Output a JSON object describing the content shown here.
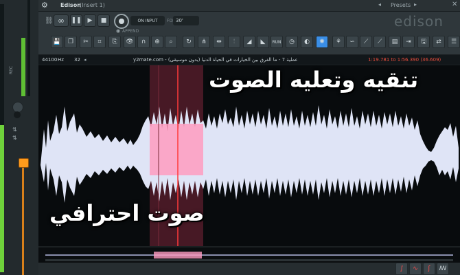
{
  "window": {
    "title": "Edison",
    "subtitle": "(Insert 1)",
    "presets_label": "Presets",
    "logo": "edison"
  },
  "left_strip": {
    "rec_label": "REC",
    "meter_color": "#6fd13b",
    "fader_color": "#ff9b1c"
  },
  "controls": {
    "loop_icon": "infinity-icon",
    "input_mode": "ON INPUT",
    "for_label": "FOR",
    "duration": "30'",
    "append_label": "APPEND"
  },
  "info": {
    "sample_rate": "44100",
    "sample_unit": "Hz",
    "bits": "32",
    "filename": "y2mate.com - عملية 7 - ما الفرق بين الخيارات في الحياة الدنيا (بدون موسيقى)",
    "selection": "1:19.781 to 1:56.390 (36.609)"
  },
  "overlay_text": {
    "top": "تنقيه وتعليه الصوت",
    "bottom": "صوت احترافي"
  },
  "colors": {
    "waveform": "#dfe4f6",
    "selection": "#ff9cc0",
    "selection_region": "#5c1f2e",
    "playhead": "#ff3b3b",
    "accent": "#3a8ee6",
    "time_readout": "#e74c3c"
  }
}
